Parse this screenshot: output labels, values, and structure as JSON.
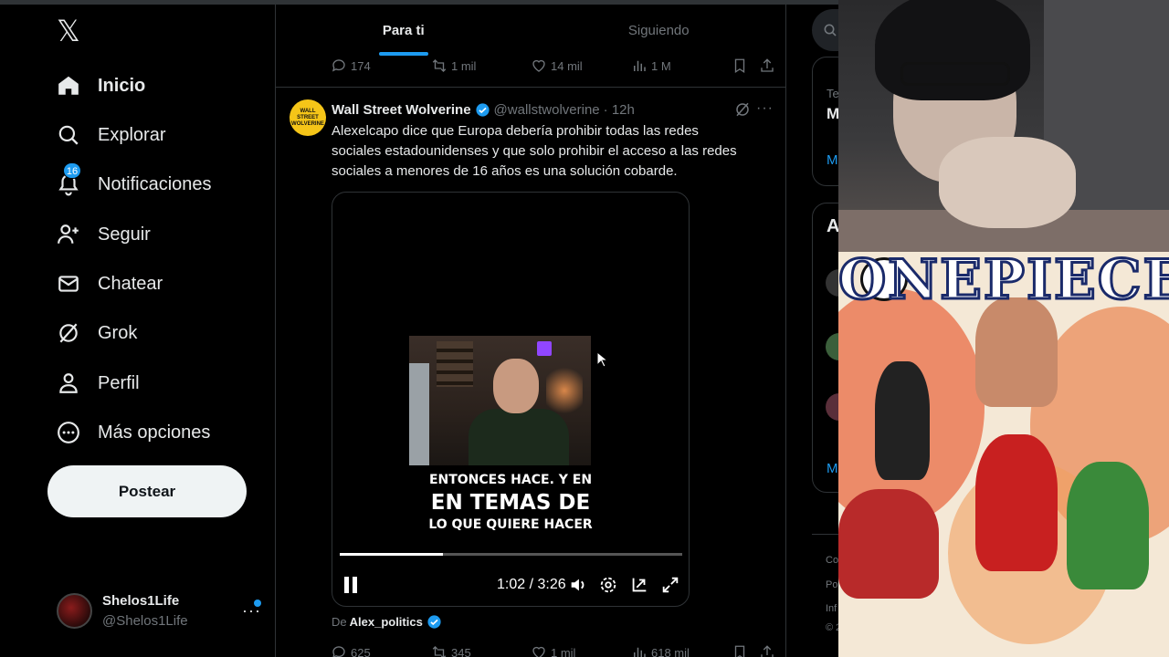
{
  "nav": {
    "items": [
      {
        "label": "Inicio",
        "icon": "home-icon",
        "active": true
      },
      {
        "label": "Explorar",
        "icon": "search-icon"
      },
      {
        "label": "Notificaciones",
        "icon": "bell-icon",
        "badge": "16"
      },
      {
        "label": "Seguir",
        "icon": "follow-icon"
      },
      {
        "label": "Chatear",
        "icon": "mail-icon"
      },
      {
        "label": "Grok",
        "icon": "grok-icon"
      },
      {
        "label": "Perfil",
        "icon": "profile-icon"
      },
      {
        "label": "Más opciones",
        "icon": "more-circle-icon"
      }
    ],
    "post_label": "Postear",
    "account": {
      "name": "Shelos1Life",
      "handle": "@Shelos1Life",
      "more": "···"
    }
  },
  "tabs": [
    {
      "label": "Para ti",
      "active": true
    },
    {
      "label": "Siguiendo",
      "active": false
    }
  ],
  "prev_tweet_actions": {
    "replies": "174",
    "reposts": "1 mil",
    "likes": "14 mil",
    "views": "1 M"
  },
  "tweet": {
    "avatar_text": "WALL STREET WOLVERINE",
    "name": "Wall Street Wolverine",
    "handle": "@wallstwolverine",
    "time": "· 12h",
    "text": "Alexelcapo dice que Europa debería prohibir todas las redes sociales estadounidenses y que solo prohibir el acceso a las redes sociales a menores de 16 años es una solución cobarde.",
    "video": {
      "caption_line1": "ENTONCES HACE. Y EN",
      "caption_line2": "EN TEMAS DE",
      "caption_line3": "LO QUE QUIERE HACER",
      "time": "1:02 / 3:26",
      "progress": 0.3
    },
    "source_prefix": "De",
    "source_name": "Alex_politics",
    "actions": {
      "replies": "625",
      "reposts": "345",
      "likes": "1 mil",
      "views": "618 mil"
    }
  },
  "right_fragments": {
    "a": "Te",
    "b": "M",
    "c": "M",
    "d": "A",
    "e": "M",
    "f": "Co",
    "g": "Po",
    "h": "Inf",
    "i": "© 2"
  },
  "manga_title": "ONEPIECE",
  "colors": {
    "accent": "#1d9bf0",
    "background": "#000000",
    "muted": "#71767b",
    "text": "#e7e9ea"
  }
}
